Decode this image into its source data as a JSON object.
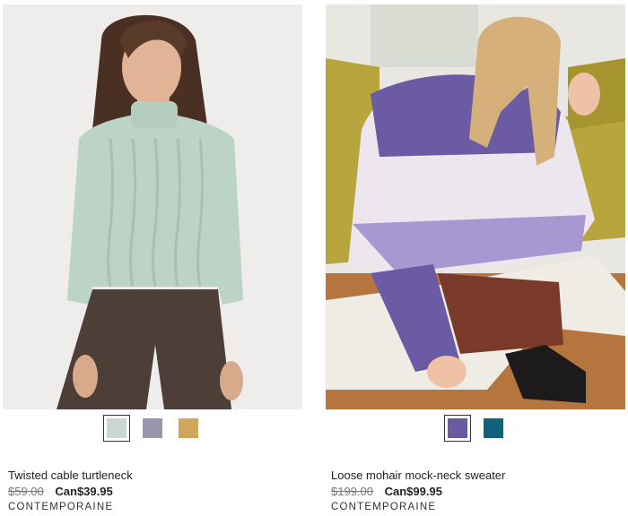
{
  "products": [
    {
      "name": "Twisted cable turtleneck",
      "original_price": "$59.00",
      "sale_price": "Can$39.95",
      "brand": "CONTEMPORAINE",
      "swatches": [
        {
          "name": "sage",
          "color": "#c9d8d0",
          "selected": true
        },
        {
          "name": "lilac",
          "color": "#9a96ad",
          "selected": false
        },
        {
          "name": "gold",
          "color": "#d1a55c",
          "selected": false
        }
      ]
    },
    {
      "name": "Loose mohair mock-neck sweater",
      "original_price": "$199.00",
      "sale_price": "Can$99.95",
      "brand": "CONTEMPORAINE",
      "swatches": [
        {
          "name": "purple stripe",
          "color": "#6a5aa3",
          "selected": true
        },
        {
          "name": "teal",
          "color": "#11617a",
          "selected": false
        }
      ]
    }
  ]
}
